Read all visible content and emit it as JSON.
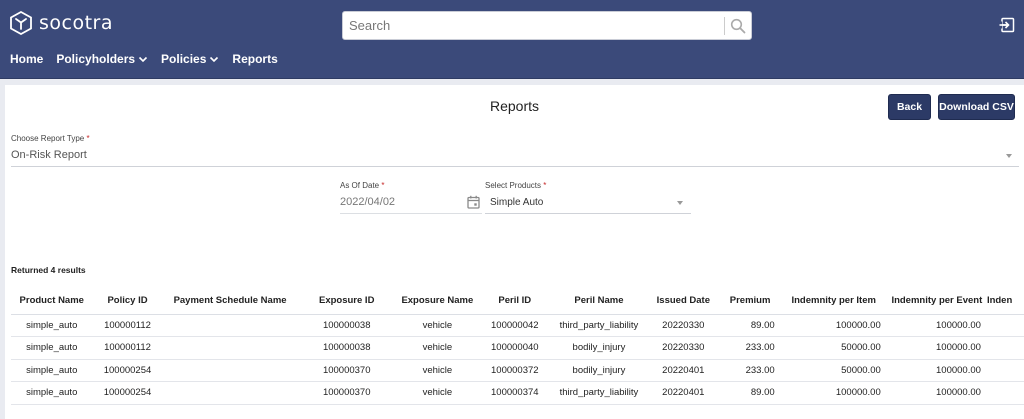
{
  "app": {
    "logo_text": "socotra"
  },
  "search": {
    "placeholder": "Search"
  },
  "nav": {
    "items": [
      {
        "label": "Home",
        "has_dropdown": false
      },
      {
        "label": "Policyholders",
        "has_dropdown": true
      },
      {
        "label": "Policies",
        "has_dropdown": true
      },
      {
        "label": "Reports",
        "has_dropdown": false
      }
    ]
  },
  "page": {
    "title": "Reports",
    "back_label": "Back",
    "download_label": "Download CSV"
  },
  "form": {
    "report_type_label": "Choose Report Type",
    "report_type_value": "On-Risk Report",
    "as_of_date_label": "As Of Date",
    "as_of_date_value": "2022/04/02",
    "products_label": "Select Products",
    "products_value": "Simple Auto",
    "required_mark": "*"
  },
  "results": {
    "summary": "Returned 4 results",
    "columns": [
      "Product Name",
      "Policy ID",
      "Payment Schedule Name",
      "Exposure ID",
      "Exposure Name",
      "Peril ID",
      "Peril Name",
      "Issued Date",
      "Premium",
      "Indemnity per Item",
      "Indemnity per Event",
      "Inden"
    ],
    "rows": [
      [
        "simple_auto",
        "100000112",
        "",
        "100000038",
        "vehicle",
        "100000042",
        "third_party_liability",
        "20220330",
        "89.00",
        "100000.00",
        "100000.00",
        ""
      ],
      [
        "simple_auto",
        "100000112",
        "",
        "100000038",
        "vehicle",
        "100000040",
        "bodily_injury",
        "20220330",
        "233.00",
        "50000.00",
        "100000.00",
        ""
      ],
      [
        "simple_auto",
        "100000254",
        "",
        "100000370",
        "vehicle",
        "100000372",
        "bodily_injury",
        "20220401",
        "233.00",
        "50000.00",
        "100000.00",
        ""
      ],
      [
        "simple_auto",
        "100000254",
        "",
        "100000370",
        "vehicle",
        "100000374",
        "third_party_liability",
        "20220401",
        "89.00",
        "100000.00",
        "100000.00",
        ""
      ]
    ]
  },
  "colors": {
    "header_bg": "#3b4a7a",
    "button_bg": "#2c3a66",
    "required": "#c62828"
  },
  "icons": [
    "socotra-logo-icon",
    "search-icon",
    "logout-icon",
    "chevron-down-icon",
    "calendar-icon",
    "dropdown-caret-icon"
  ]
}
